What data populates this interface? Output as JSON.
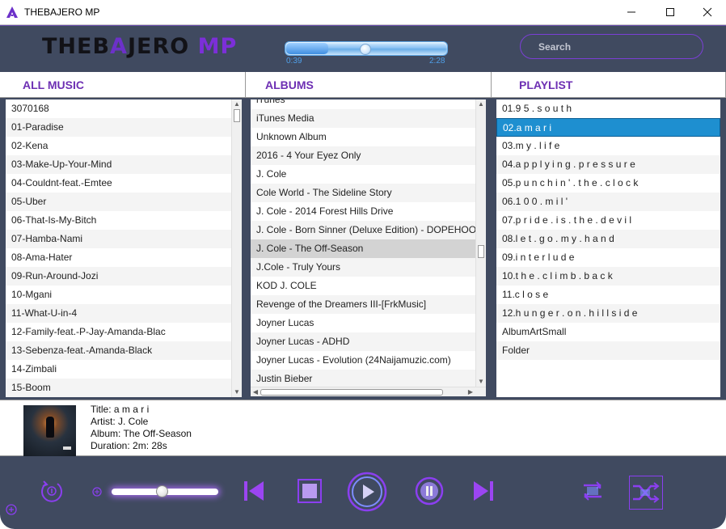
{
  "window": {
    "title": "THEBAJERO MP",
    "icon": "triangle-logo-icon",
    "controls": [
      "minimize-icon",
      "maximize-icon",
      "close-icon"
    ]
  },
  "header": {
    "brand_part1": "THEB",
    "brand_part2": "A",
    "brand_part3": "JERO",
    "brand_part4": "MP",
    "time_current": "0:39",
    "time_total": "2:28",
    "progress_fraction": 0.26,
    "search_placeholder": "Search"
  },
  "columns": {
    "all_music": "ALL MUSIC",
    "albums": "ALBUMS",
    "playlist": "PLAYLIST"
  },
  "all_music": [
    "3070168",
    "01-Paradise",
    "02-Kena",
    "03-Make-Up-Your-Mind",
    "04-Couldnt-feat.-Emtee",
    "05-Uber",
    "06-That-Is-My-Bitch",
    "07-Hamba-Nami",
    "08-Ama-Hater",
    "09-Run-Around-Jozi",
    "10-Mgani",
    "11-What-U-in-4",
    "12-Family-feat.-P-Jay-Amanda-Blac",
    "13-Sebenza-feat.-Amanda-Black",
    "14-Zimbali",
    "15-Boom"
  ],
  "albums": [
    "iTunes",
    "iTunes Media",
    "Unknown Album",
    "2016 - 4 Your Eyez Only",
    "J. Cole",
    "Cole World - The Sideline Story",
    "J. Cole - 2014 Forest Hills Drive",
    "J. Cole - Born Sinner (Deluxe Edition) - DOPEHOOD",
    "J. Cole - The Off-Season",
    "J.Cole - Truly Yours",
    "KOD J. COLE",
    "Revenge of the Dreamers III-[FrkMusic]",
    "Joyner Lucas",
    "Joyner Lucas - ADHD",
    "Joyner Lucas - Evolution (24Naijamuzic.com)",
    "Justin Bieber"
  ],
  "albums_selected_index": 8,
  "playlist": [
    "01.9 5 . s o u t h",
    "02.a m a r i",
    "03.m y . l i f e",
    "04.a p p l y i n g . p r e s s u r e",
    "05.p u n c h i n ' . t h e . c l o c k",
    "06.1 0 0 . m i l '",
    "07.p r i d e . i s . t h e . d e v i l",
    "08.l e t . g o . m y . h a n d",
    "09.i n t e r l u d e",
    "10.t h e . c l i m b . b a c k",
    "11.c l o s e",
    "12.h u n g e r . o n . h i l l s i d e",
    "AlbumArtSmall",
    "Folder"
  ],
  "playlist_selected_index": 1,
  "now_playing": {
    "title": "Title: a m a r i",
    "artist": "Artist: J. Cole",
    "album": "Album: The Off-Season",
    "duration": "Duration: 2m: 28s"
  },
  "controls": {
    "volume_fraction": 0.48,
    "icons": [
      "repeat-one-icon",
      "volume-icon",
      "previous-icon",
      "stop-icon",
      "play-icon",
      "pause-icon",
      "next-icon",
      "repeat-icon",
      "shuffle-icon",
      "add-icon"
    ]
  },
  "colors": {
    "panel": "#404a60",
    "accent": "#8b3ff0",
    "header_text": "#6d2fb3",
    "selection": "#1e8fd0"
  }
}
